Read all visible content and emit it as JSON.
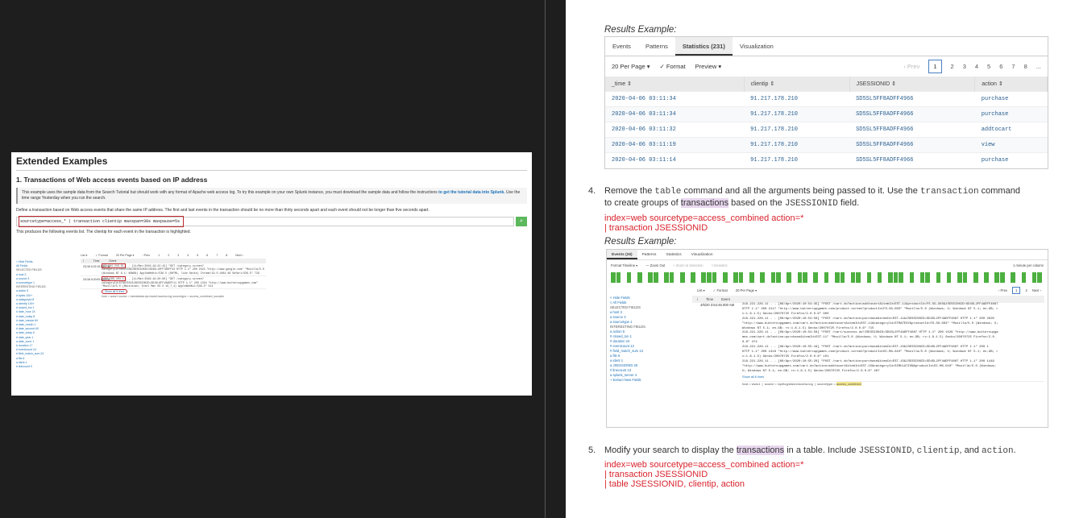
{
  "left": {
    "title": "Extended Examples",
    "subtitle": "1. Transactions of Web access events based on IP address",
    "callout_text": "This example uses the sample data from the Search Tutorial but should work with any format of Apache web access log. To try this example on your own Splunk instance, you must download the sample data and follow the instructions",
    "callout_link": "to get the tutorial data into Splunk.",
    "callout_tail": "Use the time range Yesterday when you run the search.",
    "define_text": "Define a transaction based on Web access events that share the same IP address. The first and last events in the transaction should be no more than thirty seconds apart and each event should not be longer than five seconds apart.",
    "search": "sourcetype=access_* | transaction clientip maxspan=30s maxpause=5s",
    "produces": "This produces the following events list. The clientip for each event in the transaction is highlighted.",
    "events_toolbar": [
      "List ▾",
      "✓ Format",
      "20 Per Page ▾",
      "‹ Prev",
      "1",
      "2",
      "3",
      "4",
      "5",
      "6",
      "7",
      "8",
      "Next ›"
    ],
    "events_header": [
      "i",
      "Time",
      "Event"
    ],
    "sidebar": [
      "< Hide Fields",
      "All Fields",
      "SELECTED FIELDS",
      "a host 3",
      "a source 3",
      "a sourcetype 1",
      "INTERESTING FIELDS",
      "a action 5",
      "# bytes 100+",
      "a categoryId 8",
      "a clientip 100+",
      "# closed_txn 1",
      "# date_hour 24",
      "# date_mday 8",
      "# date_minute 60",
      "a date_month 1",
      "# date_second 60",
      "a date_wday 6",
      "# date_year 1",
      "a date_zone 1",
      "# duration 17",
      "# eventcount 24",
      "# field_match_sum 24",
      "a file 6",
      "a ident 1",
      "# linecount 9"
    ],
    "events": [
      {
        "time": "2/1/16 6:22:15.000 PM",
        "ip": "87.194.216.51",
        "text": "- - [11/Mar/2016:18:22:15] \"GET /category.screen?categoryId=SHOOTER&JSESSIONID=SD3SL10FF7ADFF43 HTTP 1.1\" 200 2423 \"http://www.google.com\" \"Mozilla/5.0 (Windows NT 6.1; WOW64) AppleWebKit/536.5 (KHTML, like Gecko) Chrome/19.0.1084.46 Safari/536.5\" 729"
      },
      {
        "time": "2/1/16 6:20:00.000 PM",
        "ip": "192.168.104.1",
        "text": "- - [11/Mar/2016:18:20:00] \"GET /category.screen?categoryId=STRATEGY&JSESSIONID=SD1SL6FF10ADFF11 HTTP 1.1\" 200 1318 \"http://www.buttercupgames.com\" \"Mozilla/5.0 (Macintosh; Intel Mac OS X 10_7_4) AppleWebKit/536.5\" 512"
      }
    ],
    "show_all": "Show all 9 lines",
    "meta": "host = www1   source = tutorialdata.zip:/www1/access.log   sourcetype = access_combined_wcookie"
  },
  "right": {
    "results_label_1": "Results Example:",
    "tabs": [
      "Events",
      "Patterns",
      "Statistics (231)",
      "Visualization"
    ],
    "active_tab": 2,
    "toolbar": {
      "per_page": "20 Per Page ▾",
      "format": "✓ Format",
      "preview": "Preview ▾"
    },
    "pager": [
      "‹ Prev",
      "1",
      "2",
      "3",
      "4",
      "5",
      "6",
      "7",
      "8",
      "..."
    ],
    "columns": [
      "_time ⇕",
      "clientip ⇕",
      "JSESSIONID ⇕",
      "action ⇕"
    ],
    "rows": [
      [
        "2020-04-06 03:11:34",
        "91.217.178.210",
        "SD5SL5FF8ADFF4966",
        "purchase"
      ],
      [
        "2020-04-06 03:11:34",
        "91.217.178.210",
        "SD5SL5FF8ADFF4966",
        "purchase"
      ],
      [
        "2020-04-06 03:11:32",
        "91.217.178.210",
        "SD5SL5FF8ADFF4966",
        "addtocart"
      ],
      [
        "2020-04-06 03:11:19",
        "91.217.178.210",
        "SD5SL5FF8ADFF4966",
        "view"
      ],
      [
        "2020-04-06 03:11:14",
        "91.217.178.210",
        "SD5SL5FF8ADFF4966",
        "purchase"
      ]
    ],
    "step4": {
      "num": "4.",
      "line1_a": "Remove the ",
      "line1_code1": "table",
      "line1_b": " command and all the arguments being passed to it. Use the ",
      "line1_code2": "transaction",
      "line1_c": " command",
      "line2_a": "to create groups of ",
      "line2_mark": "transactions",
      "line2_b": " based on the ",
      "line2_code": "JSESSIONID",
      "line2_c": " field.",
      "code": [
        "index=web sourcetype=access_combined action=*",
        "| transaction JSESSIONID"
      ]
    },
    "results_label_2": "Results Example:",
    "shot2": {
      "tabs": [
        "Events (26)",
        "Patterns",
        "Statistics",
        "Visualization"
      ],
      "timeline_bar": [
        "Format Timeline ▾",
        "— Zoom Out",
        "+ Zoom to Selection",
        "× Deselect",
        "1 minute per column"
      ],
      "toolbar": [
        "List ▾",
        "✓ Format",
        "20 Per Page ▾",
        "‹ Prev",
        "1",
        "2",
        "Next ›"
      ],
      "sidebar": [
        "< Hide Fields",
        "≡ All Fields",
        "SELECTED FIELDS",
        "a host 3",
        "a source 3",
        "a sourcetype 1",
        "INTERESTING FIELDS",
        "a action 5",
        "# closed_txn 1",
        "# duration 24",
        "# eventcount 13",
        "# field_match_sum 13",
        "a file 6",
        "a ident 1",
        "a JSESSIONID 26",
        "# linecount 13",
        "a splunk_server 4",
        "+ Extract New Fields"
      ],
      "header": [
        "i",
        "Time",
        "Event"
      ],
      "time": "4/6/20 3:54:45.000 AM",
      "lines": [
        "218.221.226.11 - - [06/Apr/2020:10:54:45] \"POST /cart.do?action=addtocart&itemId=EST-11&productId=FS-SG-G03&JSESSIONID=SD4SL2FF4ADFF4087",
        "HTTP 1.1\" 200 2117 \"http://www.buttercupgames.com/product.screen?productId=FS-SG-G03\" \"Mozilla/5.0 (Windows; U; Windows NT 5.1; en-GB; r",
        "v:1.8.1.5) Gecko/20070725 Firefox/2.0.0.6\" 900",
        "218.221.226.11 - - [06/Apr/2020:10:54:56] \"POST /cart.do?action=purchase&itemId=EST-11&JSESSIONID=SD4SL2FF4ADFF4087 HTTP 1.1\" 200 2620",
        "\"http://www.buttercupgames.com/cart.do?action=addtocart&itemId=EST-11&categoryId=STRATEGY&productId=FS-SG-G03\" \"Mozilla/5.0 (Windows; U;",
        "Windows NT 5.1; en-GB; rv:1.8.1.5) Gecko/20070725 Firefox/2.0.0.6\" 715",
        "218.221.226.11 - - [06/Apr/2020:10:54:58] \"POST /cart/success.do?JSESSIONID=SD4SL2FF4ADFF4087 HTTP 1.1\" 200 1526 \"http://www.buttercupga",
        "mes.com/cart.do?action=purchase&itemId=EST-11\" \"Mozilla/5.0 (Windows; U; Windows NT 5.1; en-GB; rv:1.8.1.5) Gecko/20070725 Firefox/2.0.",
        "0.6\" 474",
        "218.221.226.11 - - [06/Apr/2020:10:55:19] \"POST /cart.do?action=purchase&itemId=EST-15&JSESSIONID=SD4SL2FF4ADFF4087 HTTP 1.1\" 200 1",
        "HTTP 1.1\" 200 1316 \"http://www.buttercupgames.com/product.screen?productId=DC-MG-G10\" \"Mozilla/5.0 (Windows; U; Windows NT 5.1; en-GB; r",
        "v:1.8.1.5) Gecko/20070725 Firefox/2.0.0.6\" 101",
        "218.221.226.11 - - [06/Apr/2020:10:55:20] \"POST /cart.do?action=purchase&itemId=EST-15&JSESSIONID=SD4SL2FF4ADFF4087 HTTP 1.1\" 200 1449",
        "\"http://www.buttercupgames.com/cart.do?action=addtocart&itemId=EST-15&categoryId=SIMULATION&productId=DC-MG-G10\" \"Mozilla/5.0 (Windows;",
        "U; Windows NT 5.1; en-GB; rv:1.8.1.5) Gecko/20070725 Firefox/2.0.0.6\" 287"
      ],
      "show_all": "Show all 6 lines",
      "meta_host": "host = www1",
      "meta_source": "source = /opt/log/www1/access.log",
      "meta_sourcetype": "sourcetype = ",
      "meta_sourcetype_val": "access_combined"
    },
    "step5": {
      "num": "5.",
      "a": "Modify your search to display the ",
      "mark": "transactions",
      "b": " in a table. Include ",
      "c1": "JSESSIONID",
      "sep1": ", ",
      "c2": "clientip",
      "sep2": ", and ",
      "c3": "action",
      "end": ".",
      "code": [
        "index=web sourcetype=access_combined action=*",
        "| transaction JSESSIONID",
        "| table JSESSIONID, clientip, action"
      ]
    }
  }
}
